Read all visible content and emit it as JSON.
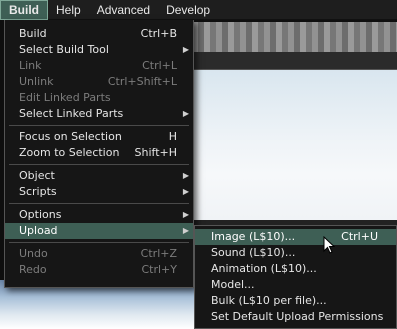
{
  "menubar": {
    "items": [
      {
        "label": "Build",
        "active": true
      },
      {
        "label": "Help"
      },
      {
        "label": "Advanced"
      },
      {
        "label": "Develop"
      }
    ]
  },
  "build_menu": {
    "items": [
      {
        "label": "Build",
        "shortcut": "Ctrl+B"
      },
      {
        "label": "Select Build Tool",
        "submenu": true
      },
      {
        "label": "Link",
        "shortcut": "Ctrl+L",
        "disabled": true
      },
      {
        "label": "Unlink",
        "shortcut": "Ctrl+Shift+L",
        "disabled": true
      },
      {
        "label": "Edit Linked Parts",
        "disabled": true
      },
      {
        "label": "Select Linked Parts",
        "submenu": true
      },
      {
        "separator": true
      },
      {
        "label": "Focus on Selection",
        "shortcut": "H"
      },
      {
        "label": "Zoom to Selection",
        "shortcut": "Shift+H"
      },
      {
        "separator": true
      },
      {
        "label": "Object",
        "submenu": true
      },
      {
        "label": "Scripts",
        "submenu": true
      },
      {
        "separator": true
      },
      {
        "label": "Options",
        "submenu": true
      },
      {
        "label": "Upload",
        "submenu": true,
        "highlighted": true
      },
      {
        "separator": true
      },
      {
        "label": "Undo",
        "shortcut": "Ctrl+Z",
        "disabled": true
      },
      {
        "label": "Redo",
        "shortcut": "Ctrl+Y",
        "disabled": true
      }
    ]
  },
  "upload_submenu": {
    "items": [
      {
        "label": "Image (L$10)...",
        "shortcut": "Ctrl+U",
        "highlighted": true
      },
      {
        "label": "Sound (L$10)..."
      },
      {
        "label": "Animation (L$10)..."
      },
      {
        "label": "Model..."
      },
      {
        "label": "Bulk (L$10 per file)..."
      },
      {
        "label": "Set Default Upload Permissions"
      }
    ]
  },
  "colors": {
    "highlight": "#3e5f55",
    "menu_bg": "#161616",
    "disabled_text": "#7c7c7c"
  },
  "icons": {
    "submenu_arrow": "triangle-right-icon",
    "cursor": "mouse-pointer-icon"
  }
}
